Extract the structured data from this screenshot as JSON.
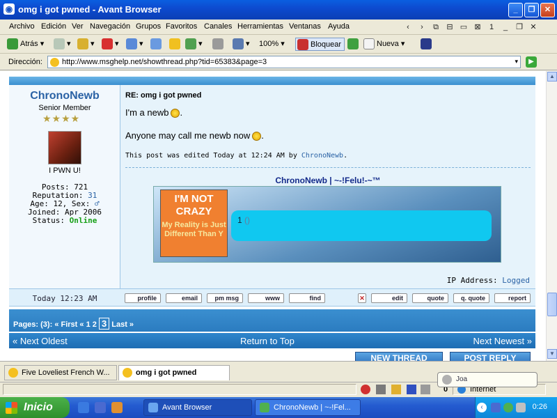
{
  "window": {
    "title": "omg i got pwned - Avant Browser",
    "min": "_",
    "max": "❐",
    "close": "✕"
  },
  "menu": [
    "Archivo",
    "Edición",
    "Ver",
    "Navegación",
    "Grupos",
    "Favoritos",
    "Canales",
    "Herramientas",
    "Ventanas",
    "Ayuda"
  ],
  "menu_controls": [
    "‹",
    "›",
    "⧉",
    "⊟",
    "▭",
    "⊠",
    "1",
    "_",
    "❐",
    "✕"
  ],
  "toolbar": {
    "back": "Atrás",
    "zoom": "100%",
    "block": "Bloquear",
    "new": "Nueva"
  },
  "address": {
    "label": "Dirección:",
    "url": "http://www.msghelp.net/showthread.php?tid=65383&page=3"
  },
  "post": {
    "username": "ChronoNewb",
    "rank": "Senior Member",
    "stars": "★★★★",
    "user_text": "I PWN U!",
    "posts": "Posts: 721",
    "reputation_label": "Reputation:",
    "reputation_value": "31",
    "age_sex": "Age: 12, Sex:",
    "sex_icon": "♂",
    "joined": "Joined: Apr 2006",
    "status_label": "Status:",
    "status_value": "Online",
    "title": "RE: omg i got pwned",
    "line1": "I'm a newb",
    "line2": "Anyone may call me newb now",
    "edited_prefix": "This post was edited Today at 12:24 AM by",
    "edited_by": "ChronoNewb",
    "sig_title": "ChronoNewb | ~-!Felu!-~™",
    "sig_img_line1": "I'M NOT",
    "sig_img_line2": "CRAZY",
    "sig_img_small": "My Reality is Just Different Than Y",
    "sig_box_text": "1",
    "sig_box_parens": "()",
    "ip_label": "IP Address:",
    "ip_value": "Logged",
    "date": "Today 12:23 AM"
  },
  "post_buttons": [
    "profile",
    "email",
    "pm msg",
    "www",
    "find",
    "edit",
    "quote",
    "q. quote",
    "report"
  ],
  "delete_icon": "✕",
  "pages": {
    "label": "Pages: (3):",
    "first": "« First",
    "prev": "«",
    "p1": "1",
    "p2": "2",
    "current": "3",
    "last": "Last »"
  },
  "nav": {
    "oldest": "« Next Oldest",
    "top": "Return to Top",
    "newest": "Next Newest »"
  },
  "big_buttons": {
    "new_thread": "NEW THREAD",
    "post_reply": "POST REPLY"
  },
  "tabs": [
    "Five Loveliest French W...",
    "omg i got pwned"
  ],
  "status": {
    "zone": "Internet",
    "count": "0"
  },
  "popup": "Joa",
  "taskbar": {
    "start": "Inicio",
    "items": [
      "Avant Browser",
      "ChronoNewb | ~-!Fel..."
    ],
    "clock": "0:26"
  }
}
